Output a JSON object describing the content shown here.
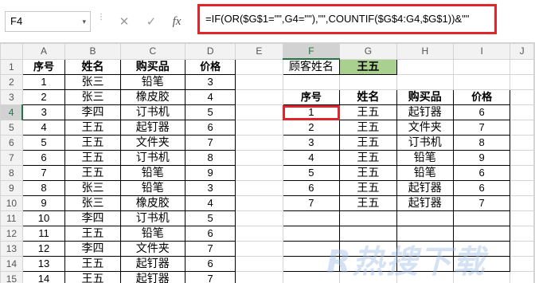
{
  "formula_bar": {
    "name_box": "F4",
    "name_box_arrow": "▾",
    "more_icon": "⋮",
    "cancel_icon": "✕",
    "enter_icon": "✓",
    "fx_icon": "fx",
    "formula": "=IF(OR($G$1=\"\",G4=\"\"),\"\",COUNTIF($G$4:G4,$G$1))&\"\""
  },
  "sheet": {
    "columns": [
      "A",
      "B",
      "C",
      "D",
      "E",
      "F",
      "G",
      "H",
      "I",
      "J"
    ],
    "rows": [
      "1",
      "2",
      "3",
      "4",
      "5",
      "6",
      "7",
      "8",
      "9",
      "10",
      "11",
      "12",
      "13",
      "14",
      "15"
    ],
    "selected_cell": "F4",
    "left_table": {
      "headers": [
        "序号",
        "姓名",
        "购买品",
        "价格"
      ],
      "rows": [
        [
          "1",
          "张三",
          "铅笔",
          "3"
        ],
        [
          "2",
          "张三",
          "橡皮胶",
          "4"
        ],
        [
          "3",
          "李四",
          "订书机",
          "5"
        ],
        [
          "4",
          "王五",
          "起钉器",
          "6"
        ],
        [
          "5",
          "王五",
          "文件夹",
          "7"
        ],
        [
          "6",
          "王五",
          "订书机",
          "8"
        ],
        [
          "7",
          "王五",
          "铅笔",
          "9"
        ],
        [
          "8",
          "张三",
          "铅笔",
          "3"
        ],
        [
          "9",
          "张三",
          "橡皮胶",
          "4"
        ],
        [
          "10",
          "李四",
          "订书机",
          "5"
        ],
        [
          "11",
          "王五",
          "铅笔",
          "6"
        ],
        [
          "12",
          "李四",
          "文件夹",
          "7"
        ],
        [
          "13",
          "王五",
          "起钉器",
          "6"
        ],
        [
          "14",
          "王五",
          "起钉器",
          "7"
        ]
      ]
    },
    "lookup": {
      "label": "顾客姓名",
      "value": "王五",
      "value_color": "#a9d08e"
    },
    "right_table": {
      "headers": [
        "序号",
        "姓名",
        "购买品",
        "价格"
      ],
      "rows": [
        [
          "1",
          "王五",
          "起钉器",
          "6"
        ],
        [
          "2",
          "王五",
          "文件夹",
          "7"
        ],
        [
          "3",
          "王五",
          "订书机",
          "8"
        ],
        [
          "4",
          "王五",
          "铅笔",
          "9"
        ],
        [
          "5",
          "王五",
          "铅笔",
          "6"
        ],
        [
          "6",
          "王五",
          "起钉器",
          "6"
        ],
        [
          "7",
          "王五",
          "起钉器",
          "7"
        ],
        [
          "",
          "",
          "",
          ""
        ],
        [
          "",
          "",
          "",
          ""
        ]
      ]
    }
  },
  "watermark": "R热搜下载",
  "colors": {
    "highlight_border": "#e0242b",
    "active_header": "#217346",
    "lookup_fill": "#a9d08e"
  }
}
